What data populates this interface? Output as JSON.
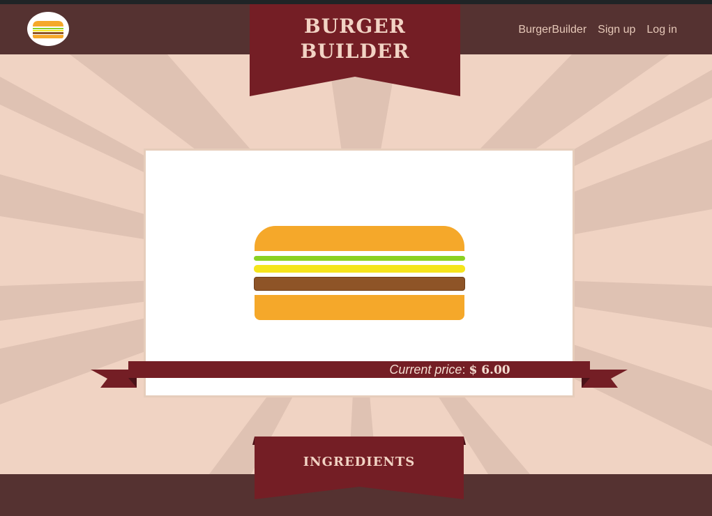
{
  "header": {
    "title_line1": "BURGER",
    "title_line2": "BUILDER",
    "logo_icon": "burger-icon",
    "nav": [
      {
        "label": "BurgerBuilder"
      },
      {
        "label": "Sign up"
      },
      {
        "label": "Log in"
      }
    ]
  },
  "burger": {
    "layers": [
      "bun-top",
      "lettuce",
      "cheese",
      "meat",
      "bun-bottom"
    ]
  },
  "price": {
    "label": "Current price",
    "value": "$ 6.00"
  },
  "ingredients": {
    "title": "INGREDIENTS"
  },
  "colors": {
    "header_bg": "#553231",
    "banner_red": "#741e25",
    "background": "#f0d3c3",
    "ray": "#dfc2b3",
    "bun": "#f5a82a",
    "lettuce": "#8ad122",
    "cheese": "#f5e51c",
    "meat": "#8e5427"
  }
}
